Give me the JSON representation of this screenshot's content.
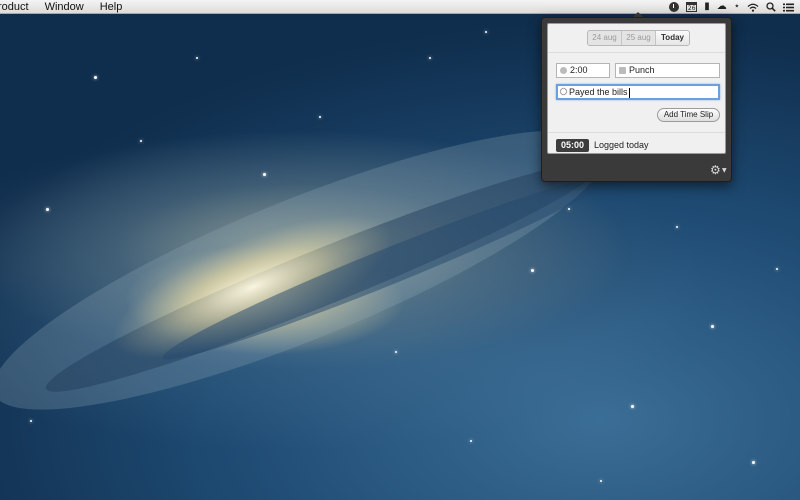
{
  "menubar": {
    "items": [
      "roduct",
      "Window",
      "Help"
    ],
    "calendar_day": "26",
    "extras": [
      "app-timer-icon",
      "calendar-icon",
      "bookmark-icon",
      "cloud-icon",
      "bluetooth-icon",
      "wifi-icon",
      "search-icon",
      "list-icon"
    ]
  },
  "popover": {
    "date_tabs": [
      "24 aug",
      "25 aug",
      "Today"
    ],
    "selected_tab": "Today",
    "duration_value": "2:00",
    "project_value": "Punch",
    "notes_value": "Payed the bills",
    "add_button_label": "Add Time Slip",
    "total_time": "05:00",
    "total_label": "Logged today"
  },
  "colors": {
    "popover_bg": "#3a3a3a",
    "panel_bg": "#f0f0f0",
    "focus_ring": "#6a9fe0",
    "badge_bg": "#3d3d3d"
  }
}
